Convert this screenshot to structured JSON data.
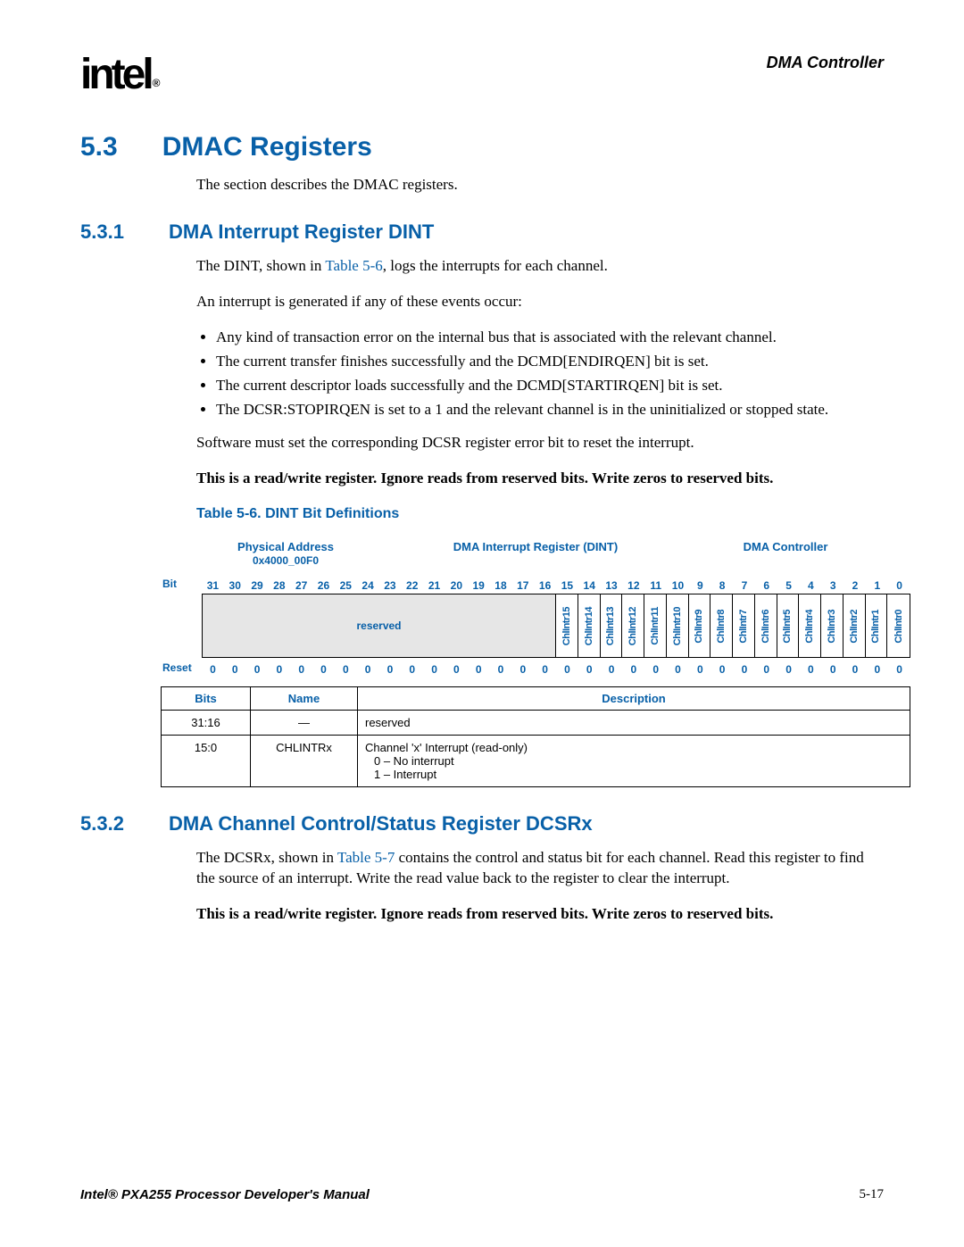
{
  "header": {
    "logo": "intel",
    "trademark": "®",
    "chapter": "DMA Controller"
  },
  "sections": {
    "s53": {
      "num": "5.3",
      "title": "DMAC Registers"
    },
    "s531": {
      "num": "5.3.1",
      "title": "DMA Interrupt Register DINT"
    },
    "s532": {
      "num": "5.3.2",
      "title": "DMA Channel Control/Status Register DCSRx"
    }
  },
  "paragraphs": {
    "p1": "The section describes the DMAC registers.",
    "p2a": "The DINT, shown in ",
    "p2link": "Table 5-6",
    "p2b": ", logs the interrupts for each channel.",
    "p3": "An interrupt is generated if any of these events occur:",
    "bul1": "Any kind of transaction error on the internal bus that is associated with the relevant channel.",
    "bul2": "The current transfer finishes successfully and the DCMD[ENDIRQEN] bit is set.",
    "bul3": "The current descriptor loads successfully and the DCMD[STARTIRQEN] bit is set.",
    "bul4": "The DCSR:STOPIRQEN is set to a 1 and the relevant channel is in the uninitialized or stopped state.",
    "p4": "Software must set the corresponding DCSR register error bit to reset the interrupt.",
    "p5": "This is a read/write register. Ignore reads from reserved bits. Write zeros to reserved bits.",
    "p6a": "The DCSRx, shown in ",
    "p6link": "Table 5-7",
    "p6b": " contains the control and status bit for each channel. Read this register to find the source of an interrupt. Write the read value back to the register to clear the interrupt.",
    "p7": "This is a read/write register. Ignore reads from reserved bits. Write zeros to reserved bits."
  },
  "table56": {
    "title": "Table 5-6. DINT Bit Definitions",
    "phys_label": "Physical Address",
    "phys_addr": "0x4000_00F0",
    "regname": "DMA Interrupt Register (DINT)",
    "block": "DMA Controller",
    "rowlabel_bit": "Bit",
    "rowlabel_reset": "Reset",
    "bits": [
      "31",
      "30",
      "29",
      "28",
      "27",
      "26",
      "25",
      "24",
      "23",
      "22",
      "21",
      "20",
      "19",
      "18",
      "17",
      "16",
      "15",
      "14",
      "13",
      "12",
      "11",
      "10",
      "9",
      "8",
      "7",
      "6",
      "5",
      "4",
      "3",
      "2",
      "1",
      "0"
    ],
    "reserved_label": "reserved",
    "bitnames": [
      "ChlIntr15",
      "ChlIntr14",
      "ChlIntr13",
      "ChlIntr12",
      "ChlIntr11",
      "ChlIntr10",
      "ChlIntr9",
      "ChlIntr8",
      "ChlIntr7",
      "ChlIntr6",
      "ChlIntr5",
      "ChlIntr4",
      "ChlIntr3",
      "ChlIntr2",
      "ChlIntr1",
      "ChlIntr0"
    ],
    "reset": [
      "0",
      "0",
      "0",
      "0",
      "0",
      "0",
      "0",
      "0",
      "0",
      "0",
      "0",
      "0",
      "0",
      "0",
      "0",
      "0",
      "0",
      "0",
      "0",
      "0",
      "0",
      "0",
      "0",
      "0",
      "0",
      "0",
      "0",
      "0",
      "0",
      "0",
      "0",
      "0"
    ],
    "desc_headers": {
      "bits": "Bits",
      "name": "Name",
      "desc": "Description"
    },
    "desc_rows": [
      {
        "bits": "31:16",
        "name": "—",
        "desc": "reserved"
      },
      {
        "bits": "15:0",
        "name": "CHLINTRx",
        "desc_l1": "Channel 'x' Interrupt (read-only)",
        "desc_l2": "0 –   No interrupt",
        "desc_l3": "1 –   Interrupt"
      }
    ]
  },
  "footer": {
    "left": "Intel® PXA255 Processor Developer's Manual",
    "right": "5-17"
  }
}
